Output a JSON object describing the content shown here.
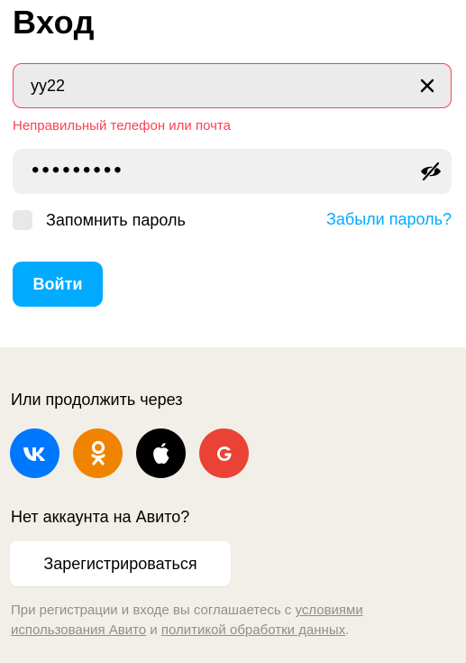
{
  "page": {
    "title": "Вход"
  },
  "login": {
    "value": "yy22",
    "error": "Неправильный телефон или почта"
  },
  "password": {
    "masked_value": "•••••••••"
  },
  "remember": {
    "label": "Запомнить пароль",
    "checked": false
  },
  "forgot": {
    "label": "Забыли пароль?"
  },
  "submit": {
    "label": "Войти"
  },
  "social": {
    "heading": "Или продолжить через",
    "providers": [
      "vk-icon",
      "odnoklassniki-icon",
      "apple-icon",
      "google-icon"
    ]
  },
  "register": {
    "question": "Нет аккаунта на Авито?",
    "button_label": "Зарегистрироваться"
  },
  "terms": {
    "prefix": "При регистрации и входе вы соглашаетесь с ",
    "link1": "условиями использования Авито",
    "middle": " и ",
    "link2": "политикой обработки данных",
    "suffix": "."
  },
  "colors": {
    "accent": "#00aaff",
    "error": "#ff4053",
    "bottom_bg": "#f2efe8",
    "vk": "#0077ff",
    "ok": "#f08300",
    "apple": "#000000",
    "google": "#ea4335"
  }
}
